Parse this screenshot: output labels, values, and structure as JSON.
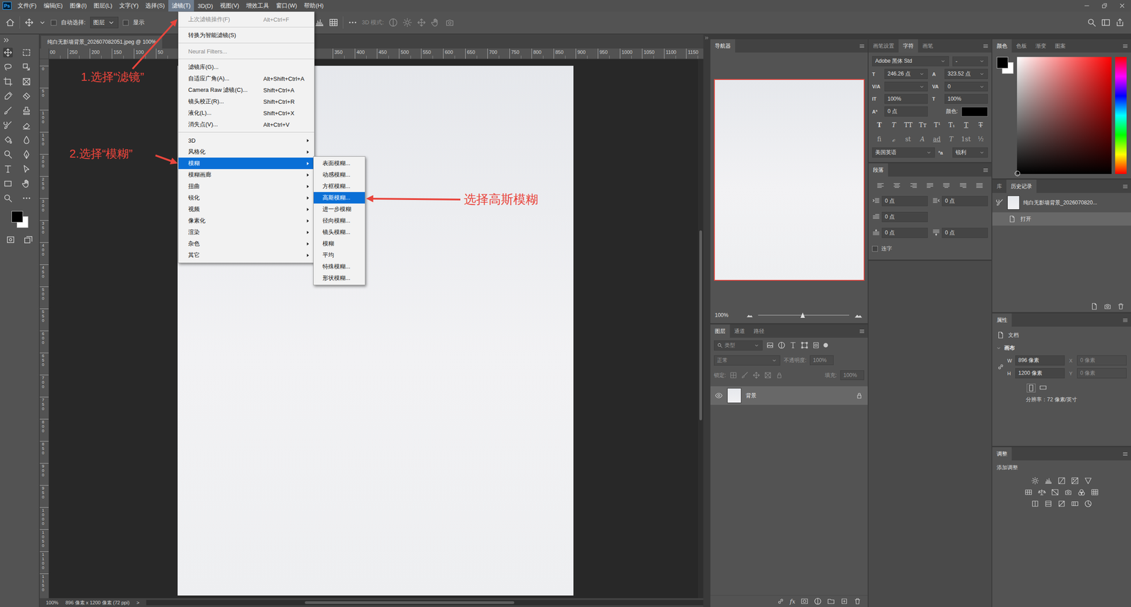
{
  "app": {
    "logo": "Ps"
  },
  "menubar": [
    {
      "label": "文件(F)",
      "selected": false
    },
    {
      "label": "编辑(E)",
      "selected": false
    },
    {
      "label": "图像(I)",
      "selected": false
    },
    {
      "label": "图层(L)",
      "selected": false
    },
    {
      "label": "文字(Y)",
      "selected": false
    },
    {
      "label": "选择(S)",
      "selected": false
    },
    {
      "label": "滤镜(T)",
      "selected": true
    },
    {
      "label": "3D(D)",
      "selected": false
    },
    {
      "label": "视图(V)",
      "selected": false
    },
    {
      "label": "增效工具",
      "selected": false
    },
    {
      "label": "窗口(W)",
      "selected": false
    },
    {
      "label": "帮助(H)",
      "selected": false
    }
  ],
  "options_bar": {
    "auto_select": {
      "label": "自动选择:",
      "checked": false
    },
    "target": {
      "value": "图层"
    },
    "show_transform": {
      "label": "显示",
      "checked": false
    },
    "mode_3d": "3D 模式:"
  },
  "document": {
    "tab": "纯白无影墙背景_202607082051.jpeg @ 100%"
  },
  "ruler_top": {
    "before_menu": [
      "00",
      "250",
      "200",
      "150",
      "100",
      "50"
    ],
    "after_menu": [
      "350",
      "400",
      "450",
      "500",
      "550",
      "600",
      "650",
      "700",
      "750",
      "800",
      "850",
      "900",
      "950",
      "1000",
      "1050",
      "1100",
      "1150"
    ]
  },
  "ruler_left": [
    "0",
    "50",
    "100",
    "150",
    "200",
    "250",
    "300",
    "350",
    "400",
    "450",
    "500",
    "550",
    "600",
    "650",
    "700",
    "750",
    "800",
    "850",
    "900",
    "950",
    "1000",
    "1050",
    "1100",
    "1150"
  ],
  "status_bar": {
    "zoom": "100%",
    "info": "896 像素 x 1200 像素 (72 ppi)",
    "arrow": ">"
  },
  "filter_menu": {
    "items": [
      {
        "kind": "item",
        "label": "上次滤镜操作(F)",
        "shortcut": "Alt+Ctrl+F",
        "disabled": true,
        "selected": false
      },
      {
        "kind": "separator"
      },
      {
        "kind": "item",
        "label": "转换为智能滤镜(S)",
        "disabled": false,
        "selected": false
      },
      {
        "kind": "separator"
      },
      {
        "kind": "item",
        "label": "Neural Filters...",
        "disabled": true,
        "selected": false
      },
      {
        "kind": "separator"
      },
      {
        "kind": "item",
        "label": "滤镜库(G)...",
        "disabled": false,
        "selected": false
      },
      {
        "kind": "item",
        "label": "自适应广角(A)...",
        "shortcut": "Alt+Shift+Ctrl+A",
        "disabled": false,
        "selected": false
      },
      {
        "kind": "item",
        "label": "Camera Raw 滤镜(C)...",
        "shortcut": "Shift+Ctrl+A",
        "disabled": false,
        "selected": false
      },
      {
        "kind": "item",
        "label": "镜头校正(R)...",
        "shortcut": "Shift+Ctrl+R",
        "disabled": false,
        "selected": false
      },
      {
        "kind": "item",
        "label": "液化(L)...",
        "shortcut": "Shift+Ctrl+X",
        "disabled": false,
        "selected": false
      },
      {
        "kind": "item",
        "label": "消失点(V)...",
        "shortcut": "Alt+Ctrl+V",
        "disabled": false,
        "selected": false
      },
      {
        "kind": "separator"
      },
      {
        "kind": "submenu",
        "label": "3D",
        "disabled": false,
        "selected": false
      },
      {
        "kind": "submenu",
        "label": "风格化",
        "disabled": false,
        "selected": false
      },
      {
        "kind": "submenu",
        "label": "模糊",
        "disabled": false,
        "selected": true
      },
      {
        "kind": "submenu",
        "label": "模糊画廊",
        "disabled": false,
        "selected": false
      },
      {
        "kind": "submenu",
        "label": "扭曲",
        "disabled": false,
        "selected": false
      },
      {
        "kind": "submenu",
        "label": "锐化",
        "disabled": false,
        "selected": false
      },
      {
        "kind": "submenu",
        "label": "视频",
        "disabled": false,
        "selected": false
      },
      {
        "kind": "submenu",
        "label": "像素化",
        "disabled": false,
        "selected": false
      },
      {
        "kind": "submenu",
        "label": "渲染",
        "disabled": false,
        "selected": false
      },
      {
        "kind": "submenu",
        "label": "杂色",
        "disabled": false,
        "selected": false
      },
      {
        "kind": "submenu",
        "label": "其它",
        "disabled": false,
        "selected": false
      }
    ]
  },
  "blur_submenu": {
    "items": [
      {
        "label": "表面模糊...",
        "selected": false
      },
      {
        "label": "动感模糊...",
        "selected": false
      },
      {
        "label": "方框模糊...",
        "selected": false
      },
      {
        "label": "高斯模糊...",
        "selected": true
      },
      {
        "label": "进一步模糊",
        "selected": false
      },
      {
        "label": "径向模糊...",
        "selected": false
      },
      {
        "label": "镜头模糊...",
        "selected": false
      },
      {
        "label": "模糊",
        "selected": false
      },
      {
        "label": "平均",
        "selected": false
      },
      {
        "label": "特殊模糊...",
        "selected": false
      },
      {
        "label": "形状模糊...",
        "selected": false
      }
    ]
  },
  "annotations": [
    {
      "text": "1.选择“滤镜”"
    },
    {
      "text": "2.选择“模糊”"
    },
    {
      "text": "选择高斯模糊"
    }
  ],
  "navigator": {
    "title": "导航器",
    "zoom": "100%",
    "level": 0.49
  },
  "layers": {
    "tabs": [
      {
        "label": "图层",
        "selected": true
      },
      {
        "label": "通道",
        "selected": false
      },
      {
        "label": "路径",
        "selected": false
      }
    ],
    "filter_placeholder": "类型",
    "blend_mode": "正常",
    "opacity": {
      "label": "不透明度:",
      "value": "100%"
    },
    "lock_label": "锁定:",
    "fill": {
      "label": "填充:",
      "value": "100%"
    },
    "items": [
      {
        "name": "背景",
        "visible": true,
        "locked": true,
        "selected": true
      }
    ],
    "footer_fx": "fx"
  },
  "character": {
    "tabs": [
      {
        "label": "画笔设置",
        "selected": false
      },
      {
        "label": "字符",
        "selected": true
      },
      {
        "label": "画笔",
        "selected": false
      }
    ],
    "font_family": "Adobe 黑体 Std",
    "font_style": "-",
    "fields": [
      {
        "icon": "T",
        "value": "246.26 点",
        "dropdown": true
      },
      {
        "icon": "A",
        "value": "323.52 点",
        "dropdown": true
      },
      {
        "icon": "V/A",
        "value": "",
        "dropdown": true
      },
      {
        "icon": "VA",
        "value": "0",
        "dropdown": true
      },
      {
        "icon": "IT",
        "value": "100%",
        "dropdown": false
      },
      {
        "icon": "T",
        "value": "100%",
        "dropdown": false
      },
      {
        "icon": "Aª",
        "value": "0 点",
        "dropdown": false
      }
    ],
    "color_label": "颜色:",
    "style_buttons": [
      {
        "glyph": "T",
        "kind": "bold"
      },
      {
        "glyph": "T",
        "kind": "italic"
      },
      {
        "glyph": "TT",
        "kind": "plain"
      },
      {
        "glyph": "Tт",
        "kind": "plain"
      },
      {
        "glyph": "T¹",
        "kind": "plain"
      },
      {
        "glyph": "T₁",
        "kind": "plain"
      },
      {
        "glyph": "T",
        "kind": "underline"
      },
      {
        "glyph": "T",
        "kind": "strike"
      }
    ],
    "opentype_buttons": [
      {
        "glyph": "fi",
        "kind": "plain"
      },
      {
        "glyph": "ℴ",
        "kind": "italic"
      },
      {
        "glyph": "st",
        "kind": "plain"
      },
      {
        "glyph": "A",
        "kind": "italic"
      },
      {
        "glyph": "ad",
        "kind": "underline"
      },
      {
        "glyph": "T",
        "kind": "italic"
      },
      {
        "glyph": "1st",
        "kind": "plain"
      },
      {
        "glyph": "½",
        "kind": "plain"
      }
    ],
    "language": "美国英语",
    "aa_icon": "ªa",
    "antialias": "锐利"
  },
  "paragraph": {
    "title": "段落",
    "rows": [
      [
        "0 点",
        "0 点"
      ],
      [
        "0 点"
      ],
      [
        "0 点",
        "0 点"
      ]
    ],
    "hyphenate": {
      "label": "连字",
      "checked": false
    }
  },
  "color": {
    "tabs": [
      {
        "label": "颜色",
        "selected": true
      },
      {
        "label": "色板",
        "selected": false
      },
      {
        "label": "渐变",
        "selected": false
      },
      {
        "label": "图案",
        "selected": false
      }
    ]
  },
  "history": {
    "tabs": [
      {
        "label": "库",
        "selected": false
      },
      {
        "label": "历史记录",
        "selected": true
      }
    ],
    "snapshot": "纯白无影墙背景_2026070820...",
    "items": [
      {
        "label": "打开",
        "selected": true
      }
    ]
  },
  "properties": {
    "title": "属性",
    "kind_label": "文档",
    "section": {
      "label": "画布",
      "expanded": true
    },
    "fields": [
      {
        "label": "W",
        "value": "896 像素",
        "disabled": false
      },
      {
        "label": "X",
        "value": "0 像素",
        "disabled": true
      },
      {
        "label": "H",
        "value": "1200 像素",
        "disabled": false
      },
      {
        "label": "Y",
        "value": "0 像素",
        "disabled": true
      }
    ],
    "resolution": "分辨率：72 像素/英寸"
  },
  "adjustments": {
    "title": "调整",
    "subtitle": "添加调整"
  }
}
